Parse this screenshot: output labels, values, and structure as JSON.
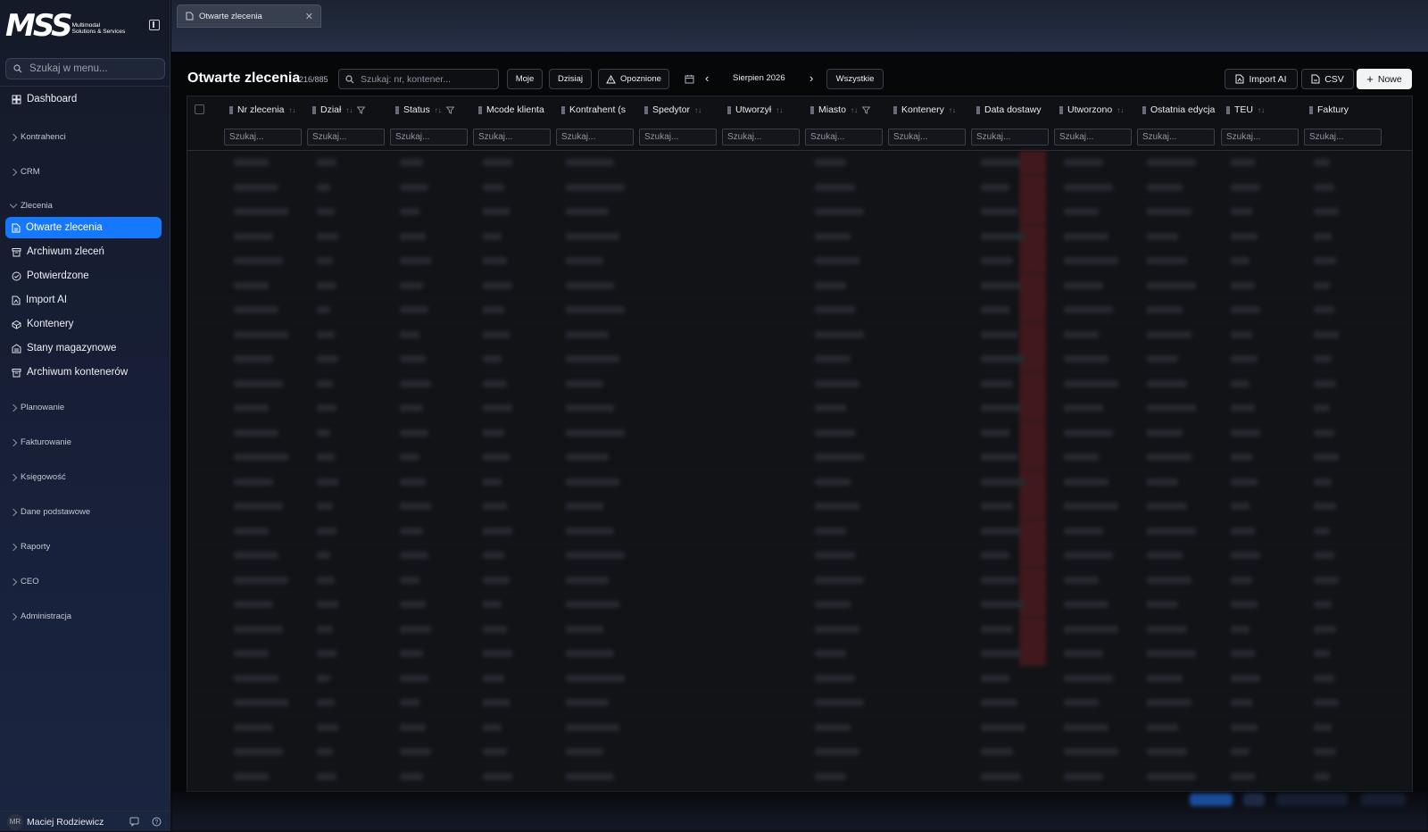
{
  "brand": {
    "logo": "MSS",
    "subtitle_line1": "Multimodal",
    "subtitle_line2": "Solutions & Services"
  },
  "sidebar": {
    "search_placeholder": "Szukaj w menu...",
    "dashboard": "Dashboard",
    "groups_top": [
      "Kontrahenci",
      "CRM"
    ],
    "zlecenia_group": "Zlecenia",
    "zlecenia_items": [
      "Otwarte zlecenia",
      "Archiwum zleceń",
      "Potwierdzone",
      "Import AI",
      "Kontenery",
      "Stany magazynowe",
      "Archiwum kontenerów"
    ],
    "groups_bottom": [
      "Planowanie",
      "Fakturowanie",
      "Księgowość",
      "Dane podstawowe",
      "Raporty",
      "CEO",
      "Administracja"
    ],
    "active_item": "Otwarte zlecenia"
  },
  "user": {
    "initials": "MR",
    "name": "Maciej Rodziewicz"
  },
  "tabs": [
    {
      "label": "Otwarte zlecenia"
    }
  ],
  "toolbar": {
    "title": "Otwarte zlecenia",
    "count": "216/885",
    "search_placeholder": "Szukaj: nr, kontener...",
    "moje": "Moje",
    "dzisiaj": "Dzisiaj",
    "opoznione": "Opoznione",
    "month": "Sierpien 2026",
    "wszystkie": "Wszystkie",
    "import_ai": "Import AI",
    "csv": "CSV",
    "nowe": "Nowe"
  },
  "table": {
    "columns": [
      "Nr zlecenia",
      "Dział",
      "Status",
      "Mcode klienta",
      "Kontrahent (s",
      "Spedytor",
      "Utworzył",
      "Miasto",
      "Kontenery",
      "Data dostawy",
      "Utworzono",
      "Ostatnia edycja",
      "TEU",
      "Faktury"
    ],
    "filter_placeholder": "Szukaj..."
  },
  "colors": {
    "accent": "#1677ff",
    "sidebar_bg": "#161d2e",
    "main_bg": "#060709"
  }
}
